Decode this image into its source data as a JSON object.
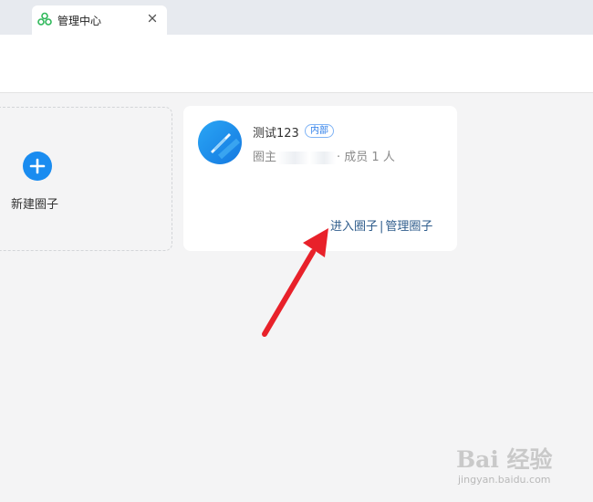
{
  "tab": {
    "title": "管理中心",
    "icon": "circles-logo-icon",
    "close_icon": "close-icon"
  },
  "new_circle": {
    "icon": "plus-icon",
    "label": "新建圈子"
  },
  "circle": {
    "name": "测试123",
    "badge": "内部",
    "owner_label": "圈主",
    "members_text": "· 成员 1 人",
    "enter_label": "进入圈子",
    "separator": "|",
    "manage_label": "管理圈子"
  },
  "watermark": {
    "main": "Bai 经验",
    "sub": "jingyan.baidu.com"
  },
  "colors": {
    "accent": "#1a8cf0",
    "link": "#2f5d8c",
    "arrow": "#e8212a",
    "tab_icon": "#2fb85a"
  }
}
